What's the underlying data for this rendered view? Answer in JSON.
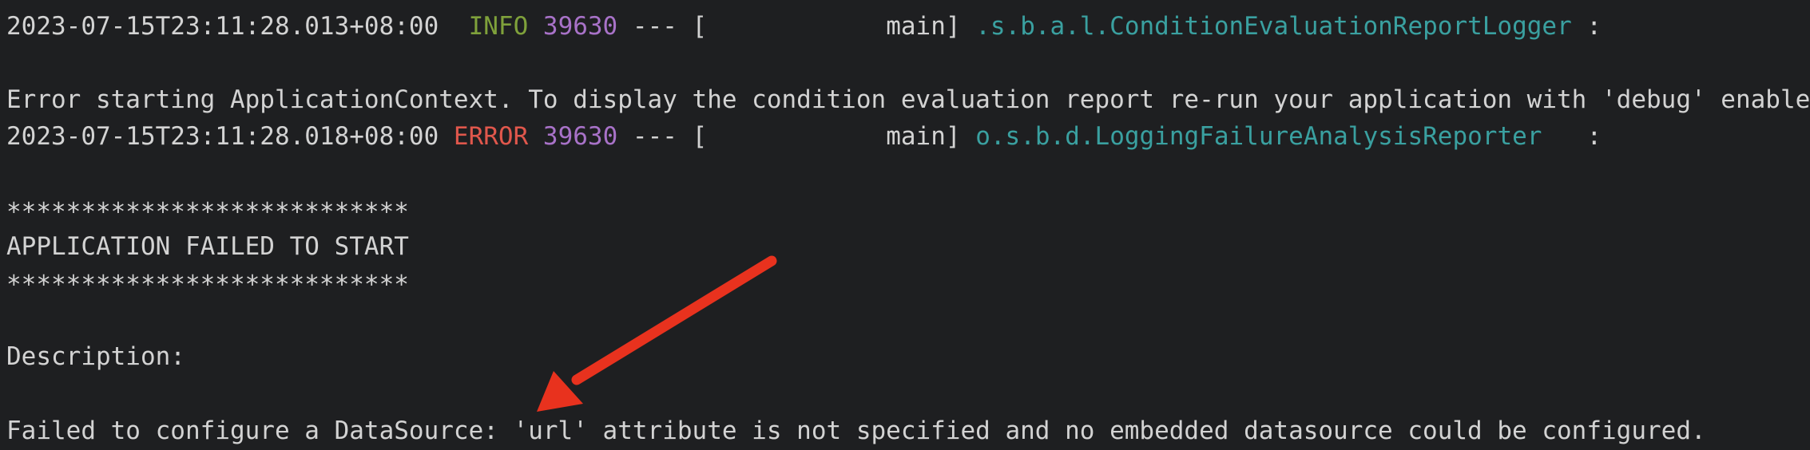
{
  "log": {
    "line1": {
      "timestamp": "2023-07-15T23:11:28.013+08:00",
      "level": "INFO",
      "pid": "39630",
      "separator": "--- [",
      "thread": "main]",
      "logger": ".s.b.a.l.ConditionEvaluationReportLogger",
      "colon": ":"
    },
    "line2": "Error starting ApplicationContext. To display the condition evaluation report re-run your application with 'debug' enabled.",
    "line3": {
      "timestamp": "2023-07-15T23:11:28.018+08:00",
      "level": "ERROR",
      "pid": "39630",
      "separator": "--- [",
      "thread": "main]",
      "logger": "o.s.b.d.LoggingFailureAnalysisReporter",
      "colon": ":"
    },
    "stars1": "***************************",
    "banner": "APPLICATION FAILED TO START",
    "stars2": "***************************",
    "description_label": "Description:",
    "failure_message": "Failed to configure a DataSource: 'url' attribute is not specified and no embedded datasource could be configured."
  },
  "colors": {
    "background": "#1e1f21",
    "text": "#d3d3d3",
    "info": "#7fa13b",
    "error": "#e0574c",
    "pid": "#a872c8",
    "logger": "#3aa0a0",
    "arrow": "#e8321e"
  },
  "annotation": {
    "icon": "red-arrow-icon"
  }
}
